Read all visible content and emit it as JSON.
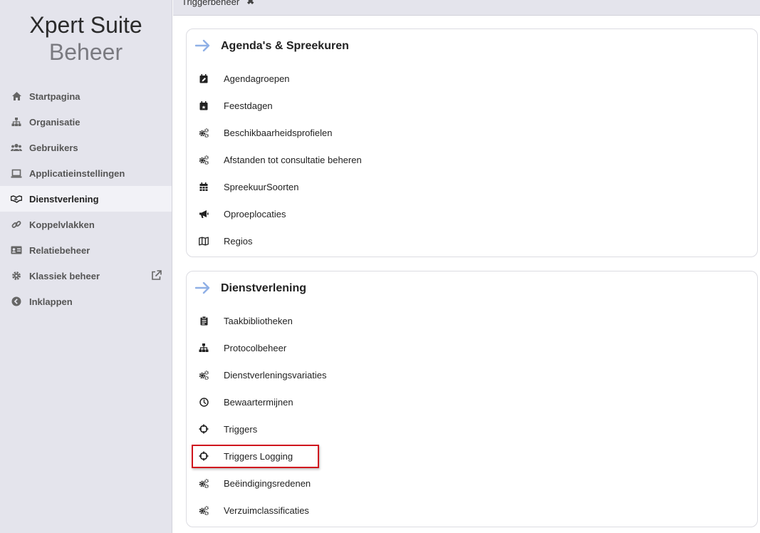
{
  "brand": {
    "name": "Xpert Suite",
    "subtitle": "Beheer"
  },
  "colors": {
    "sidebar_bg": "#e4e4ec",
    "active_bg": "#f2f2f7",
    "accent_arrow": "#8fb0e6",
    "highlight_border": "#d0161e"
  },
  "sidebar": {
    "items": [
      {
        "label": "Startpagina",
        "icon": "home-icon"
      },
      {
        "label": "Organisatie",
        "icon": "sitemap-icon"
      },
      {
        "label": "Gebruikers",
        "icon": "users-icon"
      },
      {
        "label": "Applicatieinstellingen",
        "icon": "laptop-icon"
      },
      {
        "label": "Dienstverlening",
        "icon": "handshake-icon",
        "active": true
      },
      {
        "label": "Koppelvlakken",
        "icon": "link-icon"
      },
      {
        "label": "Relatiebeheer",
        "icon": "id-card-icon"
      },
      {
        "label": "Klassiek beheer",
        "icon": "gear-icon",
        "trailing_icon": "external-link-icon"
      },
      {
        "label": "Inklappen",
        "icon": "chevron-left-circle-icon"
      }
    ]
  },
  "tabs": [
    {
      "label": "Triggerbeheer",
      "close_symbol": "✖"
    }
  ],
  "sections": [
    {
      "title": "Agenda's & Spreekuren",
      "items": [
        {
          "label": "Agendagroepen",
          "icon": "calendar-edit-icon"
        },
        {
          "label": "Feestdagen",
          "icon": "calendar-star-icon"
        },
        {
          "label": "Beschikbaarheidsprofielen",
          "icon": "cogs-icon"
        },
        {
          "label": "Afstanden tot consultatie beheren",
          "icon": "cogs-icon"
        },
        {
          "label": "SpreekuurSoorten",
          "icon": "calendar-grid-icon"
        },
        {
          "label": "Oproeplocaties",
          "icon": "megaphone-icon"
        },
        {
          "label": "Regios",
          "icon": "map-icon"
        }
      ]
    },
    {
      "title": "Dienstverlening",
      "items": [
        {
          "label": "Taakbibliotheken",
          "icon": "clipboard-icon"
        },
        {
          "label": "Protocolbeheer",
          "icon": "sitemap-icon"
        },
        {
          "label": "Dienstverleningsvariaties",
          "icon": "cogs-icon"
        },
        {
          "label": "Bewaartermijnen",
          "icon": "clock-icon"
        },
        {
          "label": "Triggers",
          "icon": "crosshairs-icon"
        },
        {
          "label": "Triggers Logging",
          "icon": "crosshairs-icon",
          "highlighted": true
        },
        {
          "label": "Beëindigingsredenen",
          "icon": "cogs-icon"
        },
        {
          "label": "Verzuimclassificaties",
          "icon": "cogs-icon"
        }
      ]
    }
  ]
}
